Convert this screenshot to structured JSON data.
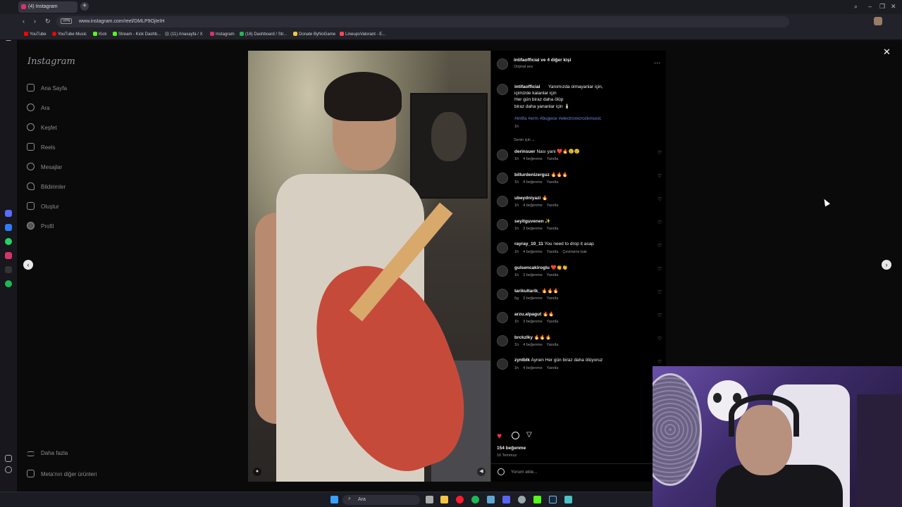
{
  "browser": {
    "tab_title": "(4) Instagram",
    "url": "www.instagram.com/reel/DMLP9OjIeIH",
    "vpn_label": "VPN",
    "bookmarks": [
      "YouTube",
      "YouTube Music",
      "Kick",
      "Stream - Kick Dashb...",
      "(11) Anasayfa / X",
      "Instagram",
      "(16) Dashboard / Str...",
      "Donate ByNoGame",
      "LineupsValorant - E..."
    ]
  },
  "sidebar": {
    "logo": "Instagram",
    "items": [
      {
        "label": "Ana Sayfa",
        "icon": "home-icon"
      },
      {
        "label": "Ara",
        "icon": "search-icon"
      },
      {
        "label": "Keşfet",
        "icon": "explore-icon"
      },
      {
        "label": "Reels",
        "icon": "reels-icon"
      },
      {
        "label": "Mesajlar",
        "icon": "messages-icon"
      },
      {
        "label": "Bildirimler",
        "icon": "heart-icon"
      },
      {
        "label": "Oluştur",
        "icon": "create-icon"
      },
      {
        "label": "Profil",
        "icon": "profile-icon"
      }
    ],
    "more": "Daha fazla",
    "meta": "Meta'nın diğer ürünleri"
  },
  "post": {
    "header_user": "intifaofficial ve 4 diğer kişi",
    "header_sub": "Orijinal ses",
    "caption_user": "intifaofficial",
    "caption_lines": [
      "Yanımızda olmayanlar için,",
      "içimizde kalanlar için",
      "Her gün biraz daha ölüp",
      "biraz daha yananlar için 🕯️"
    ],
    "hashtags": "#intifa #erm #bugece #electronicrockmusic",
    "caption_time": "1h",
    "sort_label": "Senin için",
    "likes": "154 beğenme",
    "date": "16 Temmuz",
    "comment_placeholder": "Yorum ekle..."
  },
  "comments": [
    {
      "user": "derinsuer",
      "text": "Nası yani ❤️🔥😢😢",
      "time": "1h",
      "likes": "4 beğenme",
      "reply": "Yanıtla",
      "extra": ""
    },
    {
      "user": "billurdenizerguz",
      "text": "🔥🔥🔥",
      "time": "1h",
      "likes": "4 beğenme",
      "reply": "Yanıtla",
      "extra": ""
    },
    {
      "user": "ubeydniyazi",
      "text": "🔥",
      "time": "1h",
      "likes": "4 beğenme",
      "reply": "Yanıtla",
      "extra": ""
    },
    {
      "user": "seyitguvenen",
      "text": "✨",
      "time": "1h",
      "likes": "3 beğenme",
      "reply": "Yanıtla",
      "extra": ""
    },
    {
      "user": "rayray_10_11",
      "text": "You need to drop it asap",
      "time": "1h",
      "likes": "4 beğenme",
      "reply": "Yanıtla",
      "extra": "Çevirisine bak"
    },
    {
      "user": "gulsencakiroglu",
      "text": "❤️👏👏",
      "time": "1h",
      "likes": "3 beğenme",
      "reply": "Yanıtla",
      "extra": ""
    },
    {
      "user": "tarikultarik_",
      "text": "🔥🔥🔥",
      "time": "5g",
      "likes": "2 beğenme",
      "reply": "Yanıtla",
      "extra": ""
    },
    {
      "user": "arzu.alpagut",
      "text": "🔥🔥",
      "time": "1h",
      "likes": "3 beğenme",
      "reply": "Yanıtla",
      "extra": ""
    },
    {
      "user": "brckzlky",
      "text": "🔥🔥🔥",
      "time": "1h",
      "likes": "4 beğenme",
      "reply": "Yanıtla",
      "extra": ""
    },
    {
      "user": "zynlblk",
      "text": "Aynen Her gün biraz daha ölüyoruz",
      "time": "1h",
      "likes": "4 beğenme",
      "reply": "Yanıtla",
      "extra": ""
    }
  ],
  "taskbar": {
    "search_label": "Ara"
  },
  "colors": {
    "accent_like": "#ff3040",
    "link": "#6f86d8"
  }
}
